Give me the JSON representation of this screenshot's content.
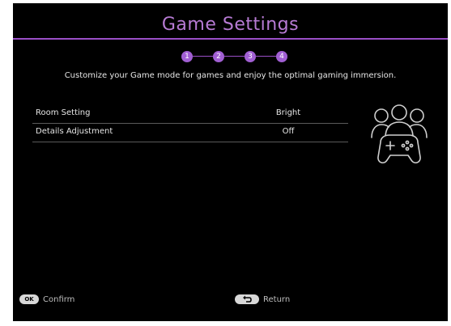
{
  "header": {
    "title": "Game Settings"
  },
  "steps": [
    "1",
    "2",
    "3",
    "4"
  ],
  "description": "Customize your Game mode for games and enjoy the optimal gaming immersion.",
  "settings": [
    {
      "label": "Room Setting",
      "value": "Bright"
    },
    {
      "label": "Details Adjustment",
      "value": "Off"
    }
  ],
  "footer": {
    "ok_key": "OK",
    "confirm_label": "Confirm",
    "return_label": "Return"
  },
  "colors": {
    "accent": "#a15fd3",
    "title": "#b77bd4",
    "background": "#000000"
  },
  "icons": {
    "illustration": "group-gamepad-icon",
    "return": "return-arrow-icon"
  }
}
